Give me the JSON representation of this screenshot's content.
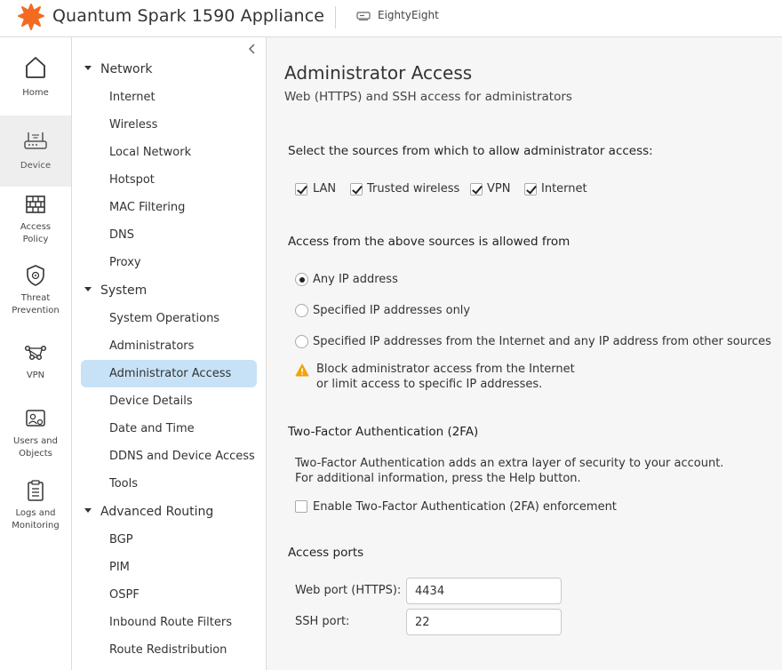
{
  "header": {
    "app_title": "Quantum Spark 1590 Appliance",
    "device_name": "EightyEight",
    "brand_color": "#f26b21"
  },
  "rail": {
    "items": [
      {
        "label": "Home",
        "icon": "home-icon",
        "active": false
      },
      {
        "label": "Device",
        "icon": "router-icon",
        "active": true
      },
      {
        "label": "Access Policy",
        "icon": "firewall-icon",
        "active": false
      },
      {
        "label": "Threat Prevention",
        "icon": "shield-icon",
        "active": false
      },
      {
        "label": "VPN",
        "icon": "vpn-network-icon",
        "active": false
      },
      {
        "label": "Users and Objects",
        "icon": "user-card-icon",
        "active": false
      },
      {
        "label": "Logs and Monitoring",
        "icon": "clipboard-icon",
        "active": false
      }
    ]
  },
  "subnav": {
    "groups": [
      {
        "label": "Network",
        "items": [
          "Internet",
          "Wireless",
          "Local Network",
          "Hotspot",
          "MAC Filtering",
          "DNS",
          "Proxy"
        ]
      },
      {
        "label": "System",
        "items": [
          "System Operations",
          "Administrators",
          "Administrator Access",
          "Device Details",
          "Date and Time",
          "DDNS and Device Access",
          "Tools"
        ]
      },
      {
        "label": "Advanced Routing",
        "items": [
          "BGP",
          "PIM",
          "OSPF",
          "Inbound Route Filters",
          "Route Redistribution"
        ]
      }
    ],
    "active_item": "Administrator Access",
    "active_color": "#c7e2f7"
  },
  "main": {
    "title": "Administrator Access",
    "subtitle": "Web (HTTPS) and SSH access for administrators",
    "sources": {
      "heading": "Select the sources from which to allow administrator access:",
      "options": [
        {
          "label": "LAN",
          "checked": true
        },
        {
          "label": "Trusted wireless",
          "checked": true
        },
        {
          "label": "VPN",
          "checked": true
        },
        {
          "label": "Internet",
          "checked": true
        }
      ]
    },
    "allowed_from": {
      "heading": "Access from the above sources is allowed from",
      "options": [
        {
          "label": "Any IP address",
          "selected": true
        },
        {
          "label": "Specified IP addresses only",
          "selected": false
        },
        {
          "label": "Specified IP addresses from the Internet and any IP address from other sources",
          "selected": false
        }
      ],
      "warning_line1": "Block administrator access from the Internet",
      "warning_line2": "or limit access to specific IP addresses.",
      "warning_color": "#f0a30a"
    },
    "tfa": {
      "heading": "Two-Factor Authentication (2FA)",
      "desc_line1": "Two-Factor Authentication adds an extra layer of security to your account.",
      "desc_line2": "For additional information, press the Help button.",
      "enable_label": "Enable Two-Factor Authentication (2FA) enforcement",
      "enabled": false
    },
    "ports": {
      "heading": "Access ports",
      "web_label": "Web port (HTTPS):",
      "web_value": "4434",
      "ssh_label": "SSH port:",
      "ssh_value": "22"
    }
  }
}
